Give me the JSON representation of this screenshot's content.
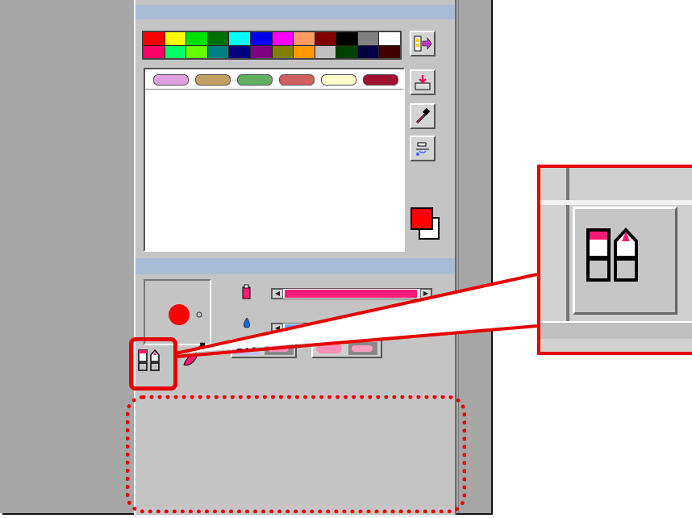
{
  "palette": {
    "swatch_colors": [
      "#ff0000",
      "#ffff00",
      "#00e000",
      "#007000",
      "#00ffff",
      "#0000ee",
      "#ff00ff",
      "#ff9966",
      "#800000",
      "#000000",
      "#808080",
      "#ffffff",
      "#ff0066",
      "#00ff66",
      "#66ff00",
      "#008080",
      "#000080",
      "#800080",
      "#808000",
      "#ff9900",
      "#c0c0c0",
      "#004000",
      "#000040",
      "#400000"
    ],
    "pill_colors": [
      "#e0a0e0",
      "#c0a060",
      "#60b060",
      "#d06060",
      "#ffffcc",
      "#a01030"
    ],
    "current_color": "#ff0000",
    "background_color": "#ffffff"
  },
  "side_tools": [
    {
      "name": "export-palette-icon"
    },
    {
      "name": "insert-color-icon"
    },
    {
      "name": "eyedropper-icon"
    },
    {
      "name": "blend-color-icon"
    }
  ],
  "brush": {
    "dot_color": "#ff0000",
    "density_color": "#ff1a75",
    "water_color": "#3399ff"
  },
  "annotations": {
    "highlight_color": "#e60000",
    "zoom_target": "brush-type-icon"
  }
}
